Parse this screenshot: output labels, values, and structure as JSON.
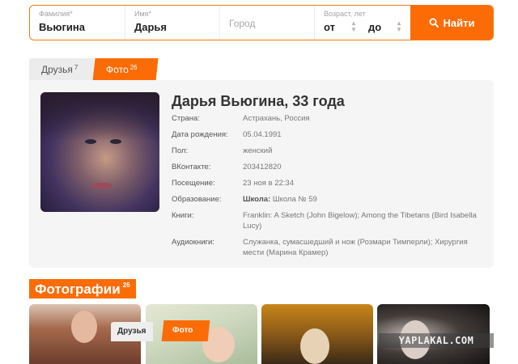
{
  "search": {
    "last_name_label": "Фамилия*",
    "last_name_value": "Вьюгина",
    "first_name_label": "Имя*",
    "first_name_value": "Дарья",
    "city_placeholder": "Город",
    "age_label": "Возраст, лет",
    "age_from": "от",
    "age_to": "до",
    "submit_label": "Найти",
    "submit_icon": "search-icon"
  },
  "tabs": [
    {
      "label": "Друзья",
      "count": "7",
      "active": false
    },
    {
      "label": "Фото",
      "count": "26",
      "active": true
    }
  ],
  "profile": {
    "name": "Дарья Вьюгина, 33 года",
    "fields": [
      {
        "key": "Страна:",
        "value": "Астрахань, Россия"
      },
      {
        "key": "Дата рождения:",
        "value": "05.04.1991"
      },
      {
        "key": "Пол:",
        "value": "женский"
      },
      {
        "key": "ВКонтакте:",
        "value": "203412820"
      },
      {
        "key": "Посещение:",
        "value": "23 ноя в 22:34"
      },
      {
        "key": "Образование:",
        "value_bold": "Школа:",
        "value": "Школа № 59"
      },
      {
        "key": "Книги:",
        "value": "Franklin: A Sketch (John Bigelow); Among the Tibetans (Bird Isabella Lucy)"
      },
      {
        "key": "Аудиокниги:",
        "value": "Служанка, сумасшедший и нож (Розмари Тимперли); Хирургия мести (Марина Крамер)"
      }
    ]
  },
  "photos": {
    "heading": "Фотографии",
    "count": "26",
    "overlay_tabs": {
      "friends": "Друзья",
      "photo": "Фото"
    }
  },
  "watermark": "YAPLAKAL.COM",
  "colors": {
    "accent": "#fb6c07",
    "card_bg": "#f5f5f5"
  }
}
